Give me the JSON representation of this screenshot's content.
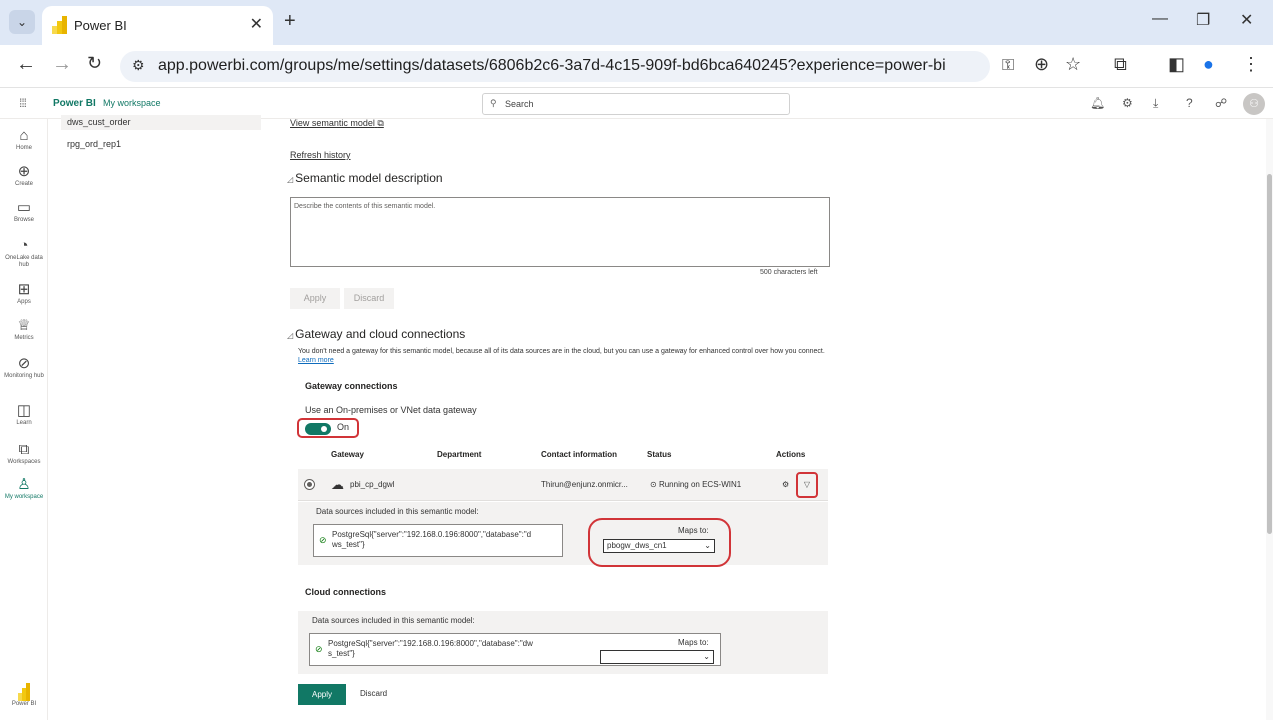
{
  "browser": {
    "tab_title": "Power BI",
    "url": "app.powerbi.com/groups/me/settings/datasets/6806b2c6-3a7d-4c15-909f-bd6bca640245?experience=power-bi"
  },
  "header": {
    "brand": "Power BI",
    "workspace": "My workspace",
    "search_placeholder": "Search"
  },
  "leftnav": {
    "home": "Home",
    "create": "Create",
    "browse": "Browse",
    "onelake": "OneLake data hub",
    "apps": "Apps",
    "metrics": "Metrics",
    "monitoring": "Monitoring hub",
    "learn": "Learn",
    "workspaces": "Workspaces",
    "my_workspace": "My workspace",
    "powerbi": "Power BI"
  },
  "sublist": {
    "items": [
      "dws_cust_order",
      "rpg_ord_rep1"
    ]
  },
  "main": {
    "view_model_link": "View semantic model",
    "refresh_history": "Refresh history",
    "description_title": "Semantic model description",
    "description_placeholder": "Describe the contents of this semantic model.",
    "chars_left": "500 characters left",
    "apply": "Apply",
    "discard": "Discard",
    "gateway_title": "Gateway and cloud connections",
    "gateway_info": "You don't need a gateway for this semantic model, because all of its data sources are in the cloud, but you can use a gateway for enhanced control over how you connect.",
    "learn_more": "Learn more",
    "gateway_connections": "Gateway connections",
    "use_gateway": "Use an On-premises or VNet data gateway",
    "toggle_state": "On",
    "columns": {
      "gateway": "Gateway",
      "department": "Department",
      "contact": "Contact information",
      "status": "Status",
      "actions": "Actions"
    },
    "gateway_row": {
      "name": "pbi_cp_dgwl",
      "contact": "Thirun@enjunz.onmicr...",
      "status": "Running on ECS-WIN1"
    },
    "ds_included": "Data sources included in this semantic model:",
    "gw_ds_line1": "PostgreSql{\"server\":\"192.168.0.196:8000\",\"database\":\"d",
    "gw_ds_line2": "ws_test\"}",
    "maps_to": "Maps to:",
    "gw_mapping": "pbogw_dws_cn1",
    "cloud_connections": "Cloud connections",
    "cloud_ds_line1": "PostgreSql{\"server\":\"192.168.0.196:8000\",\"database\":\"dw",
    "cloud_ds_line2": "s_test\"}",
    "cloud_mapping": "",
    "apply_final": "Apply",
    "discard_final": "Discard"
  },
  "colors": {
    "accent": "#117865",
    "highlight": "#d13438"
  }
}
